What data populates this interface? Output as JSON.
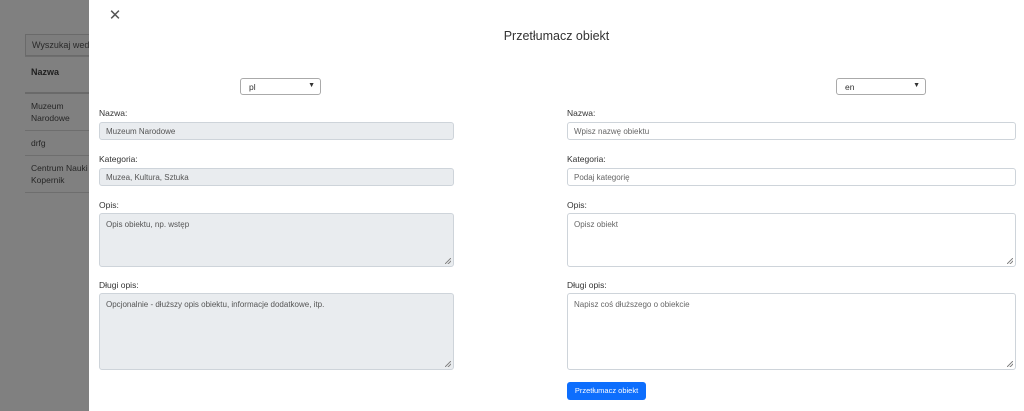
{
  "background": {
    "search_placeholder": "Wyszukaj według",
    "table_header": "Nazwa",
    "rows": [
      "Muzeum Narodowe",
      "drfg",
      "Centrum Nauki Kopernik"
    ]
  },
  "modal": {
    "title": "Przetłumacz obiekt",
    "submit_label": "Przetłumacz obiekt",
    "left": {
      "language": "pl",
      "name_label": "Nazwa:",
      "name_value": "Muzeum Narodowe",
      "category_label": "Kategoria:",
      "category_value": "Muzea, Kultura, Sztuka",
      "description_label": "Opis:",
      "description_value": "Opis obiektu, np. wstęp",
      "long_description_label": "Długi opis:",
      "long_description_value": "Opcjonalnie - dłuższy opis obiektu, informacje dodatkowe, itp."
    },
    "right": {
      "language": "en",
      "name_label": "Nazwa:",
      "name_placeholder": "Wpisz nazwę obiektu",
      "category_label": "Kategoria:",
      "category_placeholder": "Podaj kategorię",
      "description_label": "Opis:",
      "description_placeholder": "Opisz obiekt",
      "long_description_label": "Długi opis:",
      "long_description_placeholder": "Napisz coś dłuższego o obiekcie"
    }
  },
  "colors": {
    "primary": "#0d6efd",
    "overlay": "#808080",
    "disabled_field": "#e9ecef"
  },
  "icons": {
    "close": "close-icon",
    "chevron": "chevron-down-icon"
  }
}
